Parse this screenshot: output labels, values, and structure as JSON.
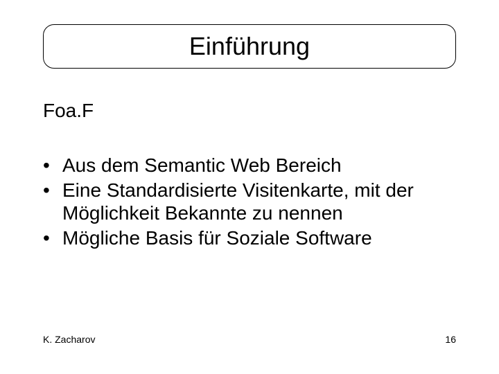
{
  "title": "Einführung",
  "subtitle": "Foa.F",
  "bullets": [
    "Aus dem Semantic Web Bereich",
    "Eine Standardisierte Visitenkarte, mit der Möglichkeit Bekannte zu nennen",
    "Mögliche Basis für Soziale Software"
  ],
  "footer": {
    "author": "K. Zacharov",
    "page": "16"
  }
}
